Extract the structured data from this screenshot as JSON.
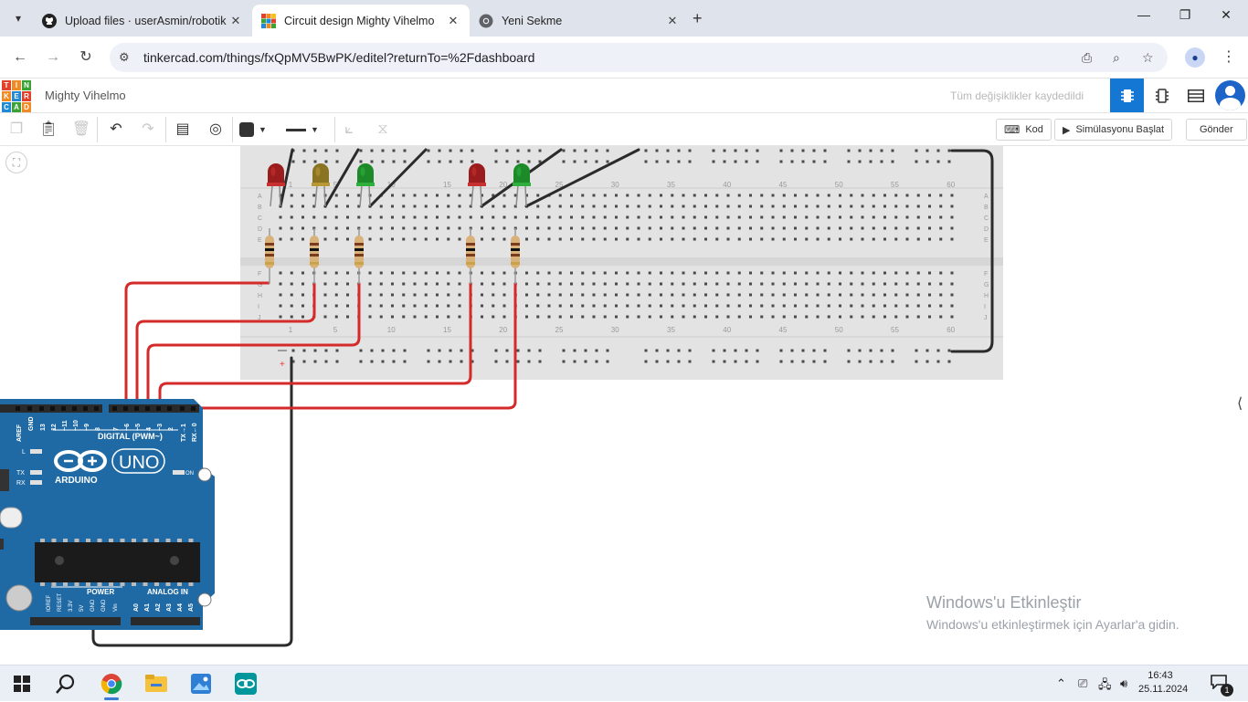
{
  "browser": {
    "tabs": [
      {
        "title": "Upload files · userAsmin/robotik",
        "active": false,
        "favicon": "github-icon"
      },
      {
        "title": "Circuit design Mighty Vihelmo",
        "active": true,
        "favicon": "tinkercad-icon"
      },
      {
        "title": "Yeni Sekme",
        "active": false,
        "favicon": "chrome-icon"
      }
    ],
    "url": "tinkercad.com/things/fxQpMV5BwPK/editel?returnTo=%2Fdashboard"
  },
  "app": {
    "logo_letters": [
      "T",
      "I",
      "N",
      "K",
      "E",
      "R",
      "C",
      "A",
      "D"
    ],
    "design_name": "Mighty Vihelmo",
    "save_status": "Tüm değişiklikler kaydedildi",
    "buttons": {
      "code": "Kod",
      "start_simulation": "Simülasyonu Başlat",
      "send": "Gönder"
    }
  },
  "breadboard": {
    "column_numbers": [
      "1",
      "5",
      "10",
      "15",
      "20",
      "25",
      "30",
      "35",
      "40",
      "45",
      "50",
      "55",
      "60"
    ],
    "row_letters_top": [
      "A",
      "B",
      "C",
      "D",
      "E"
    ],
    "row_letters_bottom": [
      "F",
      "G",
      "H",
      "I",
      "J"
    ],
    "rail_minus": "−",
    "rail_plus": "+"
  },
  "components": {
    "leds": [
      {
        "color": "red"
      },
      {
        "color": "yellow"
      },
      {
        "color": "green"
      },
      {
        "color": "red"
      },
      {
        "color": "green"
      }
    ],
    "arduino": {
      "brand": "ARDUINO",
      "model": "UNO",
      "digital_label": "DIGITAL (PWM~)",
      "digital_pins": [
        "AREF",
        "GND",
        "13",
        "12",
        "~11",
        "~10",
        "~9",
        "8",
        "7",
        "~6",
        "~5",
        "4",
        "~3",
        "2",
        "TX→1",
        "RX←0"
      ],
      "power_label": "POWER",
      "power_pins": [
        "IOREF",
        "RESET",
        "3.3V",
        "5V",
        "GND",
        "GND",
        "Vin"
      ],
      "analog_label": "ANALOG IN",
      "analog_pins": [
        "A0",
        "A1",
        "A2",
        "A3",
        "A4",
        "A5"
      ],
      "led_labels": [
        "L",
        "TX",
        "RX"
      ],
      "on_label": "ON"
    }
  },
  "watermark": {
    "line1": "Windows'u Etkinleştir",
    "line2": "Windows'u etkinleştirmek için Ayarlar'a gidin."
  },
  "taskbar": {
    "time": "16:43",
    "date": "25.11.2024",
    "notification_count": "1"
  },
  "colors": {
    "tinkercad_blue": "#1477d4",
    "arduino_blue": "#1f6aa5",
    "wire_red": "#d42a2a",
    "wire_black": "#2b2b2b",
    "breadboard": "#e3e3e3"
  }
}
